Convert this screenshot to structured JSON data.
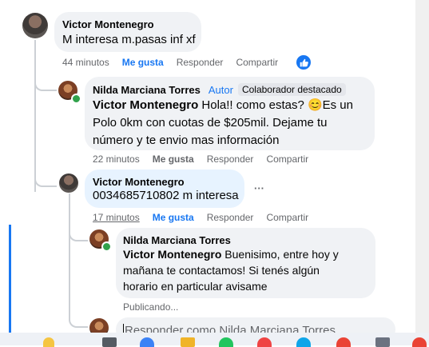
{
  "comments": [
    {
      "author": "Victor Montenegro",
      "text": "M interesa m.pasas inf xf",
      "time": "44 minutos",
      "like_label": "Me gusta",
      "reply_label": "Responder",
      "share_label": "Compartir"
    },
    {
      "author": "Nilda Marciana Torres",
      "author_badge": "Autor",
      "top_badge": "Colaborador destacado",
      "mention": "Victor Montenegro",
      "text_line1": " Hola!! como estas? 😊Es un",
      "text_line2": "Polo 0km con cuotas de $205mil. Dejame tu",
      "text_line3": "número y te envio mas información",
      "time": "22 minutos",
      "like_label": "Me gusta",
      "reply_label": "Responder",
      "share_label": "Compartir"
    },
    {
      "author": "Victor Montenegro",
      "text": "0034685710802 m interesa",
      "more_label": "···",
      "time": "17 minutos",
      "like_label": "Me gusta",
      "reply_label": "Responder",
      "share_label": "Compartir"
    },
    {
      "author": "Nilda Marciana Torres",
      "mention": "Victor Montenegro",
      "text_line1": " Buenisimo, entre hoy y",
      "text_line2": "mañana te contactamos! Si tenés algún",
      "text_line3": "horario en particular avisame",
      "status": "Publicando..."
    }
  ],
  "reply_box": {
    "placeholder": "Responder como Nilda Marciana Torres"
  },
  "colors": {
    "accent": "#1877f2",
    "bubble": "#f0f2f5",
    "highlight_bubble": "#e7f3ff",
    "secondary_text": "#65676b",
    "online": "#31a24c"
  },
  "icons": {
    "like_reaction": "thumbs-up-icon",
    "more": "more-options-icon"
  }
}
